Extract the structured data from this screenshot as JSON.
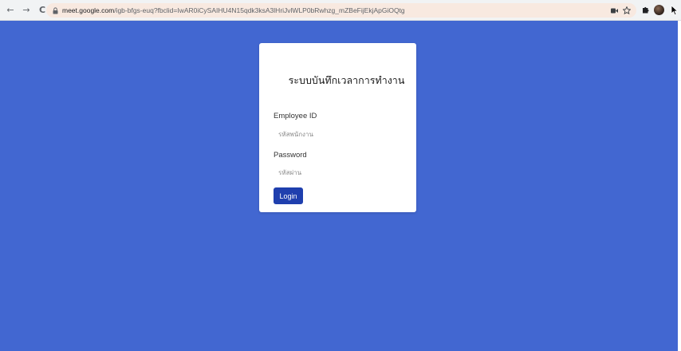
{
  "browser": {
    "url_host": "meet.google.com",
    "url_path": "/igb-bfgs-euq?fbclid=IwAR0iCySAIHU4N15qdk3ksA3lHriJvlWLP0bRwhzg_mZBeFijEkjApGiOQtg",
    "back_icon": "←",
    "forward_icon": "→",
    "reload_icon": "C"
  },
  "login_card": {
    "title": "ระบบบันทึกเวลาการทำงาน",
    "employee_id_label": "Employee ID",
    "employee_id_placeholder": "รหัสพนักงาน",
    "employee_id_value": "",
    "password_label": "Password",
    "password_placeholder": "รหัสผ่าน",
    "password_value": "",
    "login_button": "Login"
  },
  "colors": {
    "page_background": "#4267d1",
    "card_background": "#ffffff",
    "button_background": "#1f3fae"
  }
}
